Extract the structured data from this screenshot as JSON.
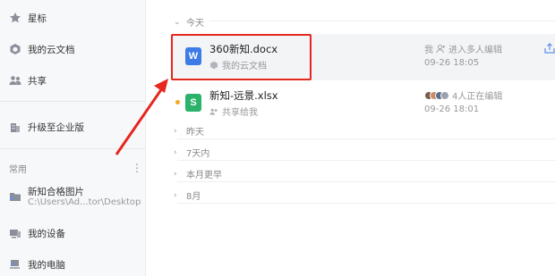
{
  "sidebar": {
    "items": [
      {
        "label": "星标",
        "icon": "star-icon"
      },
      {
        "label": "我的云文档",
        "icon": "cloud-doc-icon"
      },
      {
        "label": "共享",
        "icon": "people-icon"
      },
      {
        "label": "升级至企业版",
        "icon": "building-icon"
      }
    ],
    "section_title": "常用",
    "more": "⋮",
    "pinned": [
      {
        "label": "新知合格图片",
        "sub": "C:\\Users\\Ad...tor\\Desktop",
        "icon": "folder-icon"
      },
      {
        "label": "我的设备",
        "icon": "device-icon"
      },
      {
        "label": "我的电脑",
        "icon": "computer-icon"
      }
    ]
  },
  "main": {
    "today_label": "今天",
    "files": [
      {
        "name": "360新知.docx",
        "location": "我的云文档",
        "status": "我",
        "action": "进入多人编辑",
        "time": "09-26 18:05",
        "type_letter": "W",
        "type_color": "#3d7be6"
      },
      {
        "name": "新知-远景.xlsx",
        "location": "共享给我",
        "status": "4人正在编辑",
        "time": "09-26 18:01",
        "type_letter": "S",
        "type_color": "#2bb36b",
        "dot_color": "#f5a623"
      }
    ],
    "groups": [
      "昨天",
      "7天内",
      "本月更早",
      "8月"
    ]
  },
  "colors": {
    "highlight": "#e5271f",
    "sidebar_bg": "#f7f8fa"
  }
}
